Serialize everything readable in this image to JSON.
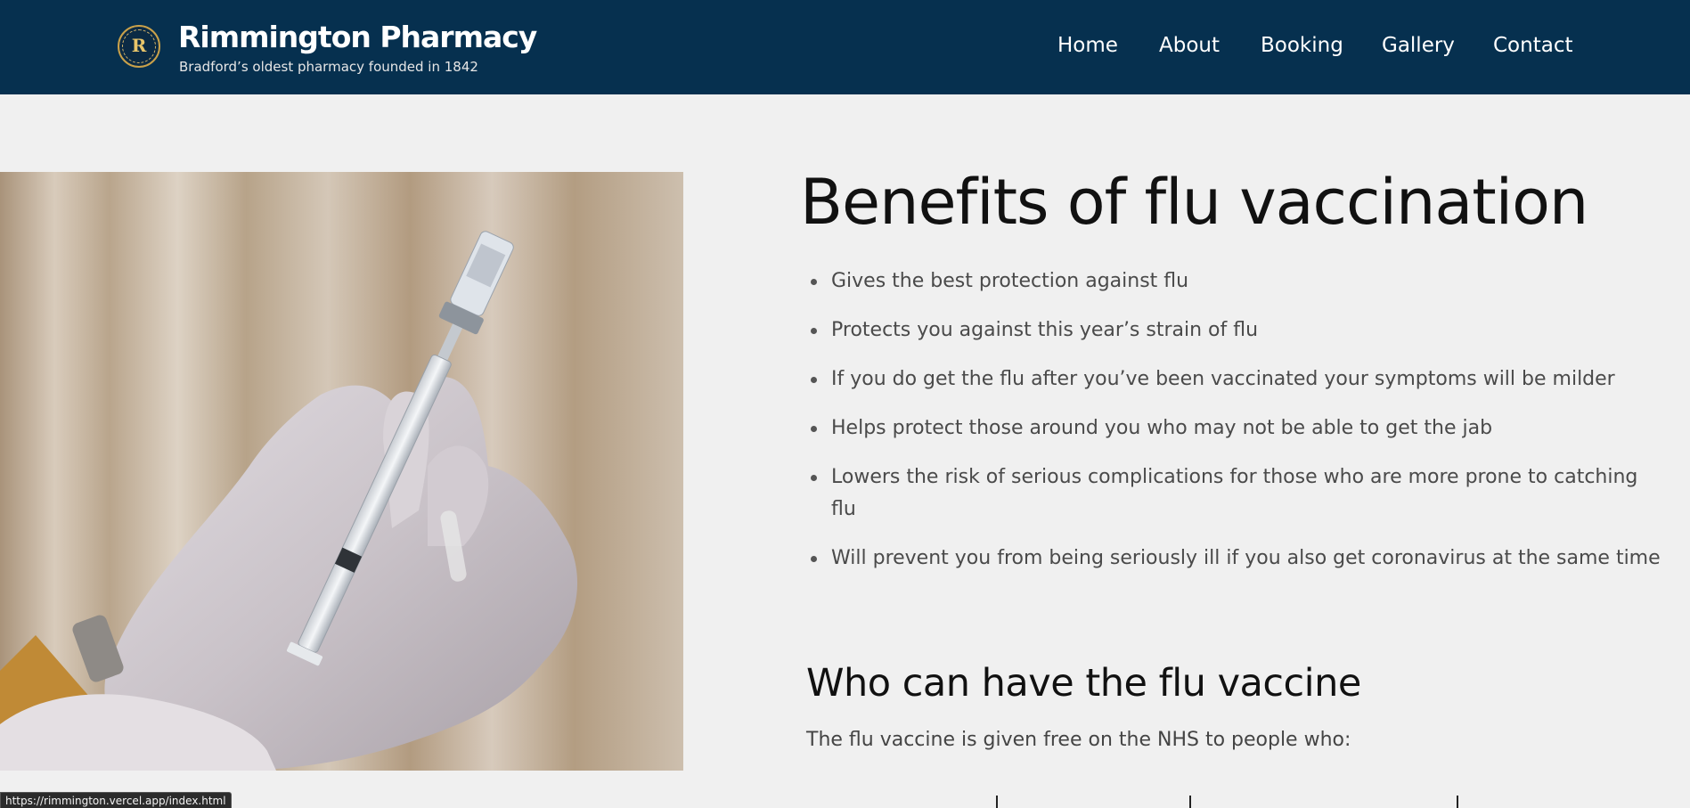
{
  "header": {
    "logo": "rimmington-pharmacy-logo",
    "title": "Rimmington Pharmacy",
    "tagline": "Bradford’s oldest pharmacy founded in 1842",
    "background": "#06304f"
  },
  "nav": {
    "items": [
      {
        "label": "Home"
      },
      {
        "label": "About"
      },
      {
        "label": "Booking"
      },
      {
        "label": "Gallery"
      },
      {
        "label": "Contact"
      }
    ]
  },
  "photo": {
    "subject": "gloved hands holding syringe and vaccine vial"
  },
  "main": {
    "title": "Benefits of flu vaccination",
    "benefits": [
      "Gives the best protection against flu",
      "Protects you against this year’s strain of flu",
      "If you do get the flu after you’ve been vaccinated your symptoms will be milder",
      "Helps protect those around you who may not be able to get the jab",
      "Lowers the risk of serious complications for those who are more prone to catching flu",
      "Will prevent you from being seriously ill if you also get coronavirus at the same time"
    ],
    "eligibility_heading": "Who can have the flu vaccine",
    "eligibility_intro": "The flu vaccine is given free on the NHS to people who:"
  },
  "status_bar": {
    "url": "https://rimmington.vercel.app/index.html"
  }
}
